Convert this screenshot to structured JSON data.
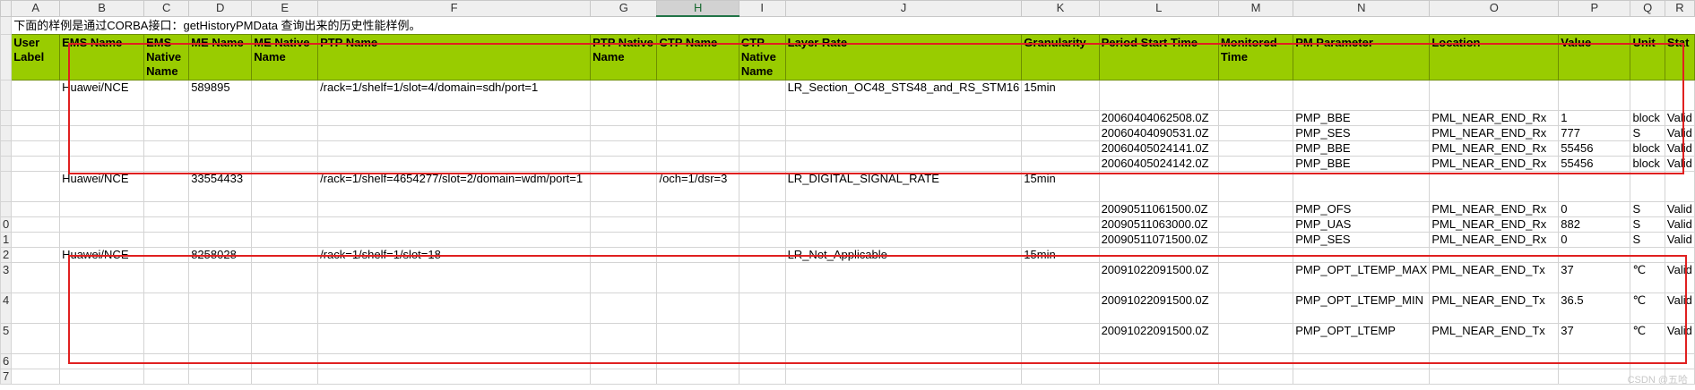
{
  "columns": [
    "A",
    "B",
    "C",
    "D",
    "E",
    "F",
    "G",
    "H",
    "I",
    "J",
    "K",
    "L",
    "M",
    "N",
    "O",
    "P",
    "Q",
    "R"
  ],
  "selected_column": "H",
  "note": "下面的样例是通过CORBA接口：getHistoryPMData 查询出来的历史性能样例。",
  "headers": [
    "User Label",
    "EMS Name",
    "EMS Native Name",
    "ME Name",
    "ME Native Name",
    "PTP Name",
    "PTP Native Name",
    "CTP Name",
    "CTP Native Name",
    "Layer Rate",
    "Granularity",
    "Period Start Time",
    "Monitored Time",
    "PM Parameter",
    "Location",
    "Value",
    "Unit",
    "Stat"
  ],
  "row_numbers": [
    "",
    "",
    "",
    "",
    "",
    "",
    "",
    "",
    "",
    "0",
    "1",
    "2",
    "3",
    "4",
    "5",
    "6",
    "7"
  ],
  "rows": [
    {
      "rn": "",
      "h": 2,
      "cells": [
        "",
        "Huawei/NCE",
        "",
        "589895",
        "",
        "/rack=1/shelf=1/slot=4/domain=sdh/port=1",
        "",
        "",
        "",
        "LR_Section_OC48_STS48_and_RS_STM16",
        "15min",
        "",
        "",
        "",
        "",
        "",
        "",
        ""
      ]
    },
    {
      "rn": "",
      "h": 1,
      "cells": [
        "",
        "",
        "",
        "",
        "",
        "",
        "",
        "",
        "",
        "",
        "",
        "20060404062508.0Z",
        "",
        "PMP_BBE",
        "PML_NEAR_END_Rx",
        "1",
        "block",
        "Valid"
      ]
    },
    {
      "rn": "",
      "h": 1,
      "cells": [
        "",
        "",
        "",
        "",
        "",
        "",
        "",
        "",
        "",
        "",
        "",
        "20060404090531.0Z",
        "",
        "PMP_SES",
        "PML_NEAR_END_Rx",
        "777",
        "S",
        "Valid"
      ]
    },
    {
      "rn": "",
      "h": 1,
      "cells": [
        "",
        "",
        "",
        "",
        "",
        "",
        "",
        "",
        "",
        "",
        "",
        "20060405024141.0Z",
        "",
        "PMP_BBE",
        "PML_NEAR_END_Rx",
        "55456",
        "block",
        "Valid"
      ]
    },
    {
      "rn": "",
      "h": 1,
      "cells": [
        "",
        "",
        "",
        "",
        "",
        "",
        "",
        "",
        "",
        "",
        "",
        "20060405024142.0Z",
        "",
        "PMP_BBE",
        "PML_NEAR_END_Rx",
        "55456",
        "block",
        "Valid"
      ]
    },
    {
      "rn": "",
      "h": 2,
      "cells": [
        "",
        "Huawei/NCE",
        "",
        "33554433",
        "",
        "/rack=1/shelf=4654277/slot=2/domain=wdm/port=1",
        "",
        "/och=1/dsr=3",
        "",
        "LR_DIGITAL_SIGNAL_RATE",
        "15min",
        "",
        "",
        "",
        "",
        "",
        "",
        ""
      ]
    },
    {
      "rn": "",
      "h": 1,
      "cells": [
        "",
        "",
        "",
        "",
        "",
        "",
        "",
        "",
        "",
        "",
        "",
        "20090511061500.0Z",
        "",
        "PMP_OFS",
        "PML_NEAR_END_Rx",
        "0",
        "S",
        "Valid"
      ]
    },
    {
      "rn": "0",
      "h": 1,
      "cells": [
        "",
        "",
        "",
        "",
        "",
        "",
        "",
        "",
        "",
        "",
        "",
        "20090511063000.0Z",
        "",
        "PMP_UAS",
        "PML_NEAR_END_Rx",
        "882",
        "S",
        "Valid"
      ]
    },
    {
      "rn": "1",
      "h": 1,
      "cells": [
        "",
        "",
        "",
        "",
        "",
        "",
        "",
        "",
        "",
        "",
        "",
        "20090511071500.0Z",
        "",
        "PMP_SES",
        "PML_NEAR_END_Rx",
        "0",
        "S",
        "Valid"
      ]
    },
    {
      "rn": "2",
      "h": 1,
      "cells": [
        "",
        "Huawei/NCE",
        "",
        "8258028",
        "",
        "/rack=1/shelf=1/slot=18",
        "",
        "",
        "",
        "LR_Not_Applicable",
        "15min",
        "",
        "",
        "",
        "",
        "",
        "",
        ""
      ]
    },
    {
      "rn": "3",
      "h": 2,
      "cells": [
        "",
        "",
        "",
        "",
        "",
        "",
        "",
        "",
        "",
        "",
        "",
        "20091022091500.0Z",
        "",
        "PMP_OPT_LTEMP_MAX",
        "PML_NEAR_END_Tx",
        "37",
        "℃",
        "Valid"
      ]
    },
    {
      "rn": "4",
      "h": 2,
      "cells": [
        "",
        "",
        "",
        "",
        "",
        "",
        "",
        "",
        "",
        "",
        "",
        "20091022091500.0Z",
        "",
        "PMP_OPT_LTEMP_MIN",
        "PML_NEAR_END_Tx",
        "36.5",
        "℃",
        "Valid"
      ]
    },
    {
      "rn": "5",
      "h": 2,
      "cells": [
        "",
        "",
        "",
        "",
        "",
        "",
        "",
        "",
        "",
        "",
        "",
        "20091022091500.0Z",
        "",
        "PMP_OPT_LTEMP",
        "PML_NEAR_END_Tx",
        "37",
        "℃",
        "Valid"
      ]
    },
    {
      "rn": "6",
      "h": 1,
      "cells": [
        "",
        "",
        "",
        "",
        "",
        "",
        "",
        "",
        "",
        "",
        "",
        "",
        "",
        "",
        "",
        "",
        "",
        ""
      ]
    },
    {
      "rn": "7",
      "h": 1,
      "cells": [
        "",
        "",
        "",
        "",
        "",
        "",
        "",
        "",
        "",
        "",
        "",
        "",
        "",
        "",
        "",
        "",
        "",
        ""
      ]
    }
  ],
  "watermark": "CSDN @五哈",
  "colors": {
    "header_fill": "#99cc00",
    "highlight_border": "#e02020",
    "grid": "#d4d4d4"
  }
}
